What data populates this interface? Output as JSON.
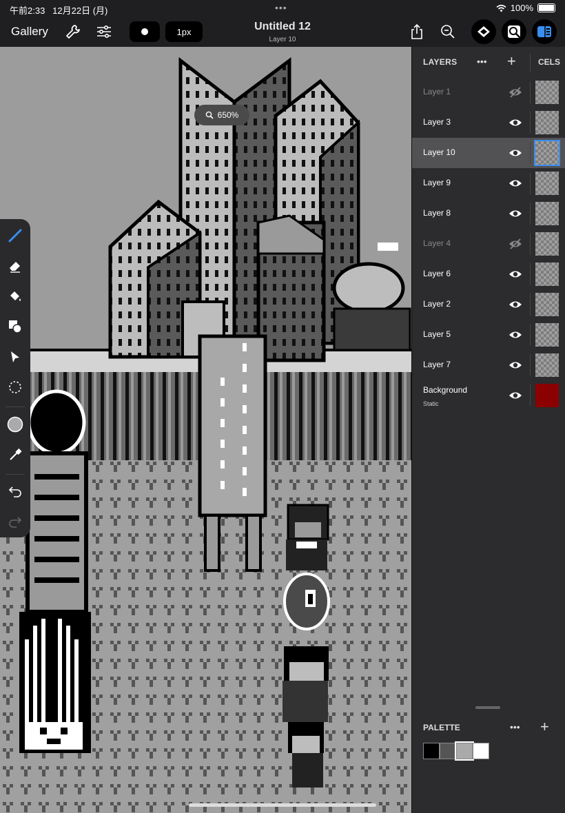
{
  "status": {
    "time": "午前2:33",
    "date": "12月22日 (月)",
    "dots": "•••",
    "battery": "100%"
  },
  "toolbar": {
    "gallery_label": "Gallery",
    "brush_size_label": "1px",
    "doc_title": "Untitled 12",
    "doc_subtitle": "Layer 10",
    "icons": [
      "wrench-icon",
      "adjustments-icon",
      "brush-dot-icon",
      "share-icon",
      "zoom-out-icon",
      "layers-icon",
      "reference-icon",
      "panel-toggle-icon"
    ]
  },
  "canvas": {
    "zoom_label": "650%"
  },
  "tools": [
    "pencil-icon",
    "eraser-icon",
    "fill-bucket-icon",
    "shapes-icon",
    "select-arrow-icon",
    "lasso-icon",
    "color-swatch-icon",
    "eyedropper-icon",
    "undo-icon",
    "redo-icon"
  ],
  "layers_panel": {
    "title": "LAYERS",
    "more": "•••",
    "add": "+",
    "cels_title": "CELS",
    "layers": [
      {
        "name": "Layer 1",
        "visible": false,
        "selected": false,
        "sub": ""
      },
      {
        "name": "Layer 3",
        "visible": true,
        "selected": false,
        "sub": ""
      },
      {
        "name": "Layer 10",
        "visible": true,
        "selected": true,
        "sub": ""
      },
      {
        "name": "Layer 9",
        "visible": true,
        "selected": false,
        "sub": ""
      },
      {
        "name": "Layer 8",
        "visible": true,
        "selected": false,
        "sub": ""
      },
      {
        "name": "Layer 4",
        "visible": false,
        "selected": false,
        "sub": ""
      },
      {
        "name": "Layer 6",
        "visible": true,
        "selected": false,
        "sub": ""
      },
      {
        "name": "Layer 2",
        "visible": true,
        "selected": false,
        "sub": ""
      },
      {
        "name": "Layer 5",
        "visible": true,
        "selected": false,
        "sub": ""
      },
      {
        "name": "Layer 7",
        "visible": true,
        "selected": false,
        "sub": ""
      },
      {
        "name": "Background",
        "visible": true,
        "selected": false,
        "sub": "Static"
      }
    ]
  },
  "palette": {
    "title": "PALETTE",
    "more": "•••",
    "add": "+",
    "colors": [
      "#000000",
      "#555555",
      "#aaaaaa",
      "#ffffff"
    ]
  },
  "colors": {
    "selection": "#3a8ef0",
    "background_layer": "#8b0000"
  }
}
